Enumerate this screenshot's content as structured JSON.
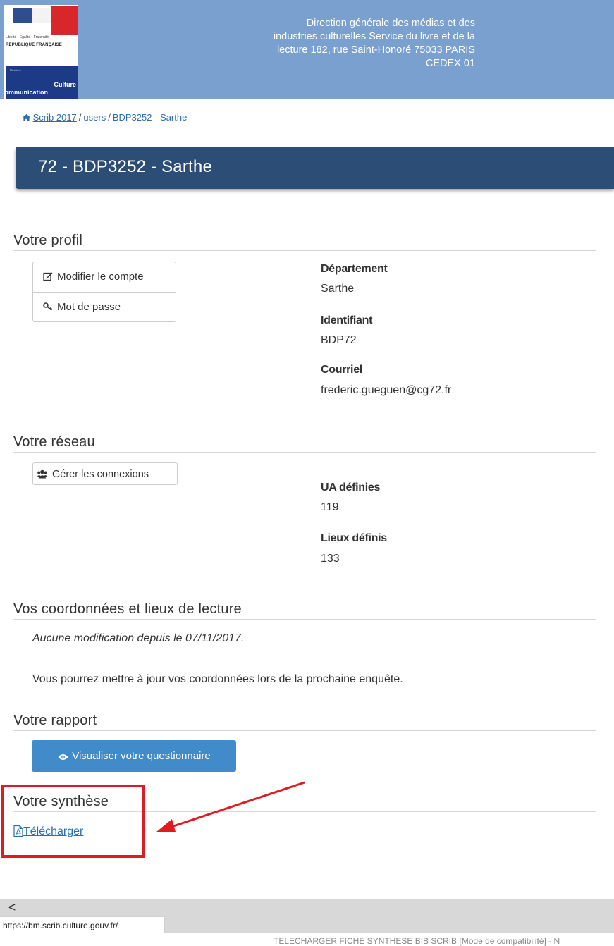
{
  "header": {
    "logo_motto": "Liberté • Égalité • Fraternité",
    "logo_republic": "RÉPUBLIQUE FRANÇAISE",
    "logo_ministry_small": "Ministère",
    "logo_ministry_line1": "Culture",
    "logo_ministry_line2": "Communication",
    "address_lines": [
      "Direction générale des médias et des",
      "industries culturelles Service du livre et de la",
      "lecture 182, rue Saint-Honoré 75033 PARIS",
      "CEDEX 01"
    ]
  },
  "breadcrumb": {
    "home": "Scrib 2017",
    "sep1": "/",
    "users": "users",
    "sep2": "/",
    "current": "BDP3252 - Sarthe"
  },
  "page_title": "72 - BDP3252 - Sarthe",
  "profile": {
    "title": "Votre profil",
    "edit_account": "Modifier le compte",
    "password": "Mot de passe",
    "department_label": "Département",
    "department_value": "Sarthe",
    "id_label": "Identifiant",
    "id_value": "BDP72",
    "email_label": "Courriel",
    "email_value": "frederic.gueguen@cg72.fr"
  },
  "network": {
    "title": "Votre réseau",
    "manage_connections": "Gérer les connexions",
    "ua_label": "UA définies",
    "ua_value": "119",
    "places_label": "Lieux définis",
    "places_value": "133"
  },
  "coordinates": {
    "title": "Vos coordonnées et lieux de lecture",
    "no_change": "Aucune modification depuis le 07/11/2017.",
    "update_note": "Vous pourrez mettre à jour vos coordonnées lors de la prochaine enquête."
  },
  "report": {
    "title": "Votre rapport",
    "view_button": "Visualiser votre questionnaire"
  },
  "synthesis": {
    "title": "Votre synthèse",
    "download": "Télécharger"
  },
  "status_bar": {
    "scroll_left": "<",
    "url": "https://bm.scrib.culture.gouv.fr/"
  },
  "taskbar": {
    "text": "TELECHARGER FICHE SYNTHESE BIB SCRIB [Mode de compatibilité] - N"
  },
  "colors": {
    "header_bg": "#7aa0cf",
    "title_bar_bg": "#2c4e76",
    "primary_button": "#428bca",
    "link": "#2a6fb0",
    "annotation_red": "#e11b22"
  }
}
